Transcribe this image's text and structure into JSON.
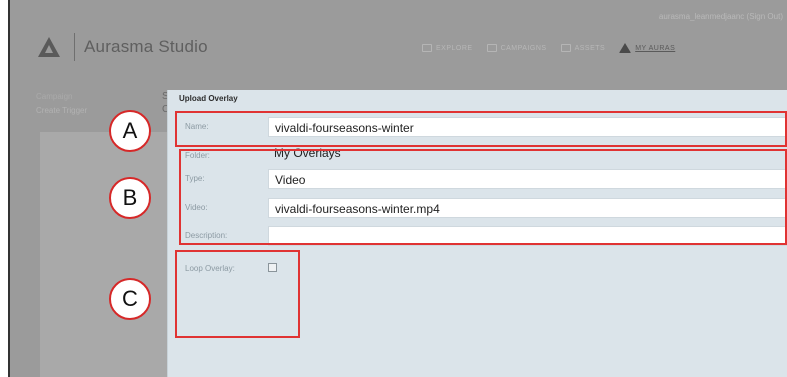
{
  "app": {
    "brand": "Aurasma Studio",
    "account": "aurasma_leanmedjaanc (Sign Out)",
    "nav": [
      {
        "label": "EXPLORE",
        "icon": "compass-icon"
      },
      {
        "label": "CAMPAIGNS",
        "icon": "campaign-icon"
      },
      {
        "label": "ASSETS",
        "icon": "assets-icon"
      },
      {
        "label": "MY AURAS",
        "icon": "aura-triangle-icon",
        "active": true
      }
    ],
    "sidebar": {
      "label": "Campaign",
      "sub": "Create Trigger",
      "fragments": [
        "S",
        "C"
      ]
    }
  },
  "dialog": {
    "title": "Upload Overlay",
    "fields": {
      "name": {
        "label": "Name:",
        "value": "vivaldi-fourseasons-winter"
      },
      "folder": {
        "label": "Folder:",
        "value": "My Overlays"
      },
      "type": {
        "label": "Type:",
        "value": "Video"
      },
      "video": {
        "label": "Video:",
        "value": "vivaldi-fourseasons-winter.mp4"
      },
      "description": {
        "label": "Description:",
        "value": ""
      },
      "loop": {
        "label": "Loop Overlay:",
        "checked": false
      }
    }
  },
  "annotations": [
    "A",
    "B",
    "C"
  ],
  "colors": {
    "highlight": "#e03333",
    "dialog_bg": "#dbe4ea"
  }
}
